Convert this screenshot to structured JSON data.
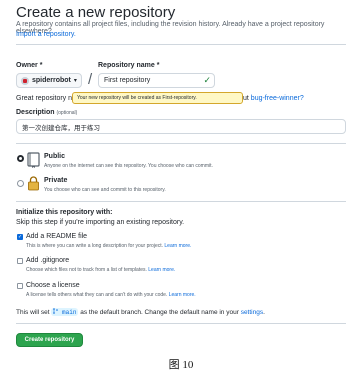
{
  "header": {
    "title": "Create a new repository",
    "subtitle": "A repository contains all project files, including the revision history. Already have a project repository elsewhere?",
    "import_link": "Import a repository."
  },
  "owner": {
    "label": "Owner *",
    "value": "spiderrobot",
    "caret": "▾"
  },
  "repo": {
    "label": "Repository name *",
    "value": "First repository",
    "check": "✓",
    "separator": "/"
  },
  "hint": {
    "prefix": "Great repository names are",
    "tooltip": "Your new repository will be created as First-repository.",
    "tail_prefix": "ut",
    "tail_link": "bug-free-winner?"
  },
  "description": {
    "label": "Description",
    "optional": "(optional)",
    "value": "第一次创建仓库，用于练习"
  },
  "visibility": {
    "public": {
      "title": "Public",
      "desc": "Anyone on the internet can see this repository. You choose who can commit."
    },
    "private": {
      "title": "Private",
      "desc": "You choose who can see and commit to this repository."
    }
  },
  "init": {
    "heading": "Initialize this repository with:",
    "subheading": "Skip this step if you're importing an existing repository.",
    "readme": {
      "label": "Add a README file",
      "desc": "This is where you can write a long description for your project.",
      "link": "Learn more."
    },
    "gitignore": {
      "label": "Add .gitignore",
      "desc": "Choose which files not to track from a list of templates.",
      "link": "Learn more."
    },
    "license": {
      "label": "Choose a license",
      "desc": "A license tells others what they can and can't do with your code.",
      "link": "Learn more."
    }
  },
  "branch": {
    "before": "This will set",
    "name": "main",
    "after": "as the default branch. Change the default name in your",
    "link": "settings",
    "end": "."
  },
  "create_button": "Create repository",
  "caption": "图 10",
  "colors": {
    "accent": "#0969da",
    "primary_button": "#2da44e",
    "tooltip_bg": "#fff8c5"
  }
}
